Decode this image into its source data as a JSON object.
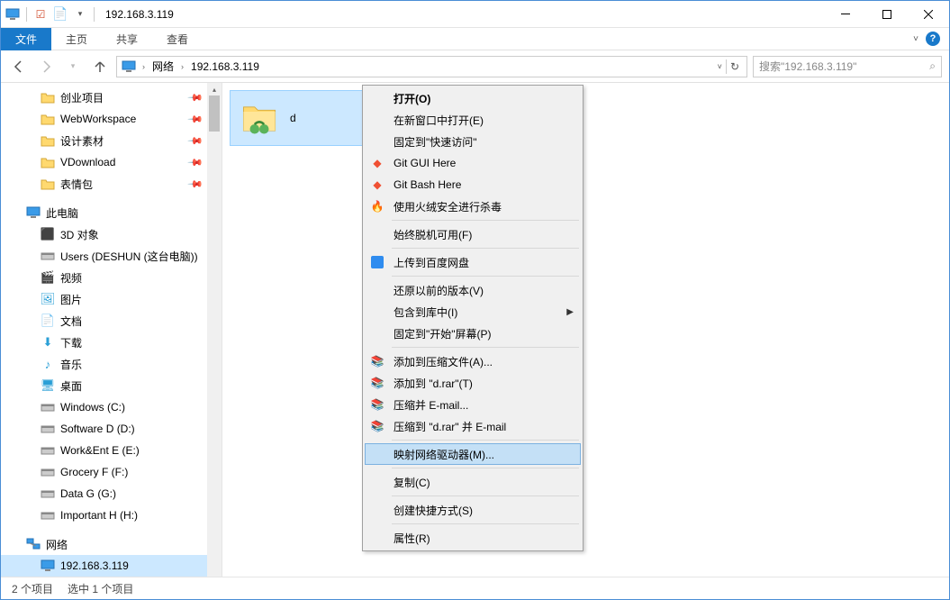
{
  "titlebar": {
    "title": "192.168.3.119"
  },
  "ribbon": {
    "file": "文件",
    "home": "主页",
    "share": "共享",
    "view": "查看"
  },
  "nav": {
    "network": "网络",
    "address": "192.168.3.119",
    "search_placeholder": "搜索\"192.168.3.119\""
  },
  "sidebar": {
    "quick": [
      {
        "label": "创业项目"
      },
      {
        "label": "WebWorkspace"
      },
      {
        "label": "设计素材"
      },
      {
        "label": "VDownload"
      },
      {
        "label": "表情包"
      }
    ],
    "thispc": "此电脑",
    "pc_items": [
      {
        "label": "3D 对象",
        "icon": "3d"
      },
      {
        "label": "Users (DESHUN (这台电脑))",
        "icon": "drive"
      },
      {
        "label": "视频",
        "icon": "video"
      },
      {
        "label": "图片",
        "icon": "pic"
      },
      {
        "label": "文档",
        "icon": "doc"
      },
      {
        "label": "下载",
        "icon": "dl"
      },
      {
        "label": "音乐",
        "icon": "music"
      },
      {
        "label": "桌面",
        "icon": "desktop"
      },
      {
        "label": "Windows (C:)",
        "icon": "drive"
      },
      {
        "label": "Software D (D:)",
        "icon": "drive"
      },
      {
        "label": "Work&Ent E (E:)",
        "icon": "drive"
      },
      {
        "label": "Grocery F (F:)",
        "icon": "drive"
      },
      {
        "label": "Data G (G:)",
        "icon": "drive"
      },
      {
        "label": "Important H (H:)",
        "icon": "drive"
      }
    ],
    "network": "网络",
    "network_items": [
      {
        "label": "192.168.3.119"
      }
    ]
  },
  "content": {
    "folder_d": "d"
  },
  "context_menu": {
    "open": "打开(O)",
    "open_new": "在新窗口中打开(E)",
    "pin_quick": "固定到\"快速访问\"",
    "git_gui": "Git GUI Here",
    "git_bash": "Git Bash Here",
    "huorong": "使用火绒安全进行杀毒",
    "always_offline": "始终脱机可用(F)",
    "baidu": "上传到百度网盘",
    "restore": "还原以前的版本(V)",
    "library": "包含到库中(I)",
    "pin_start": "固定到\"开始\"屏幕(P)",
    "rar_add": "添加到压缩文件(A)...",
    "rar_add_d": "添加到 \"d.rar\"(T)",
    "rar_email": "压缩并 E-mail...",
    "rar_email_d": "压缩到 \"d.rar\" 并 E-mail",
    "map_drive": "映射网络驱动器(M)...",
    "copy": "复制(C)",
    "shortcut": "创建快捷方式(S)",
    "properties": "属性(R)"
  },
  "statusbar": {
    "items": "2 个项目",
    "selected": "选中 1 个项目"
  }
}
